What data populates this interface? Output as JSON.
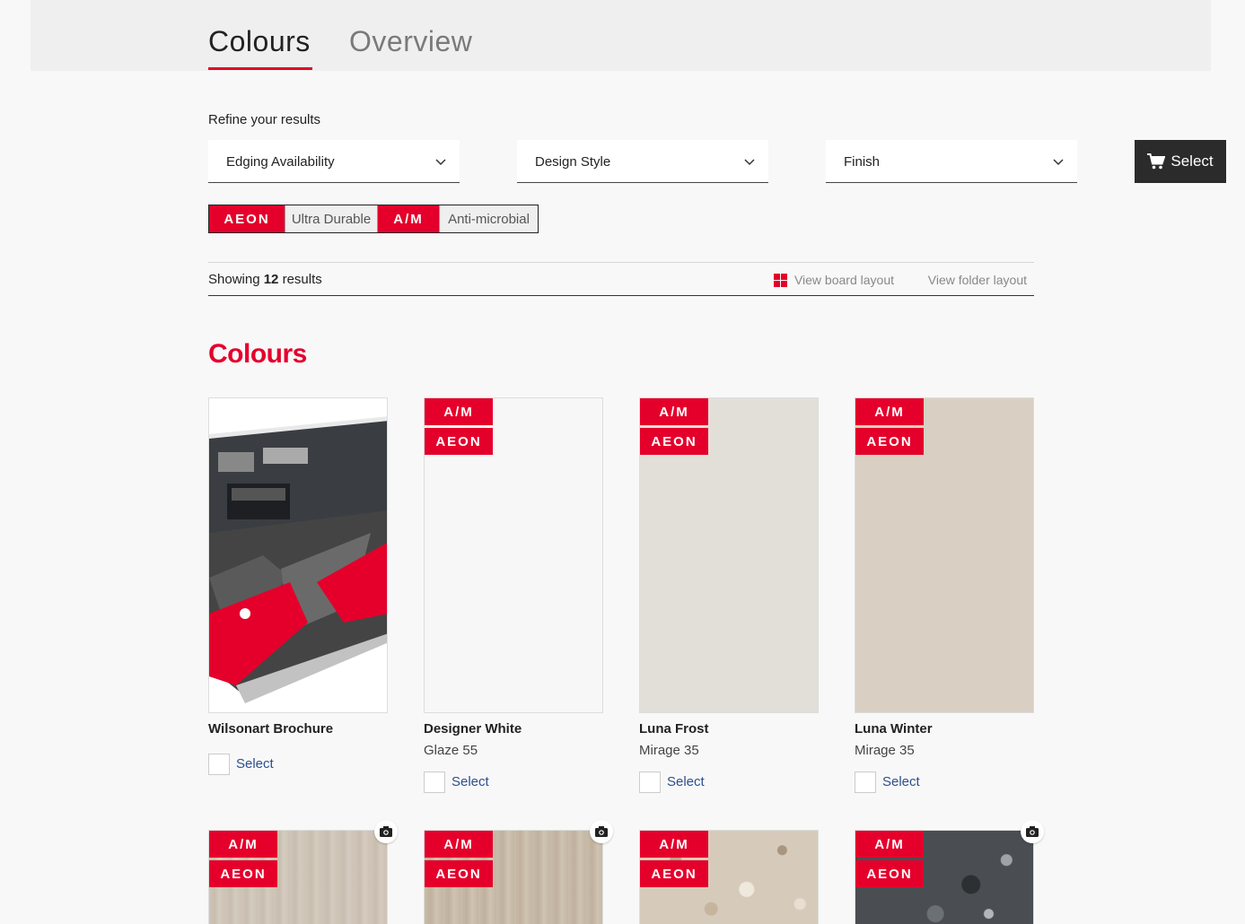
{
  "tabs": [
    {
      "label": "Colours",
      "active": true
    },
    {
      "label": "Overview",
      "active": false
    }
  ],
  "filters": {
    "refine_label": "Refine your results",
    "dropdowns": [
      {
        "label": "Edging Availability"
      },
      {
        "label": "Design Style"
      },
      {
        "label": "Finish"
      }
    ],
    "cart_button": "Select",
    "legend": {
      "aeon_badge": "AEON",
      "aeon_desc": "Ultra Durable",
      "am_badge": "A/M",
      "am_desc": "Anti-microbial"
    }
  },
  "results": {
    "prefix": "Showing",
    "count": "12",
    "suffix": "results",
    "view_board": "View board layout",
    "view_folder": "View folder layout"
  },
  "section_title": "Colours",
  "colors": {
    "accent": "#e4002b",
    "link": "#2d4f8f",
    "dark_button": "#2b2b2b"
  },
  "cards": [
    {
      "name": "Wilsonart Brochure",
      "sub": "",
      "select": "Select",
      "tags": []
    },
    {
      "name": "Designer White",
      "sub": "Glaze 55",
      "select": "Select",
      "tags": [
        "A/M",
        "AEON"
      ]
    },
    {
      "name": "Luna Frost",
      "sub": "Mirage 35",
      "select": "Select",
      "tags": [
        "A/M",
        "AEON"
      ]
    },
    {
      "name": "Luna Winter",
      "sub": "Mirage 35",
      "select": "Select",
      "tags": [
        "A/M",
        "AEON"
      ]
    }
  ],
  "row2_cards": [
    {
      "tags": [
        "A/M",
        "AEON"
      ],
      "camera": true
    },
    {
      "tags": [
        "A/M",
        "AEON"
      ],
      "camera": true
    },
    {
      "tags": [
        "A/M",
        "AEON"
      ],
      "camera": false
    },
    {
      "tags": [
        "A/M",
        "AEON"
      ],
      "camera": true
    }
  ]
}
